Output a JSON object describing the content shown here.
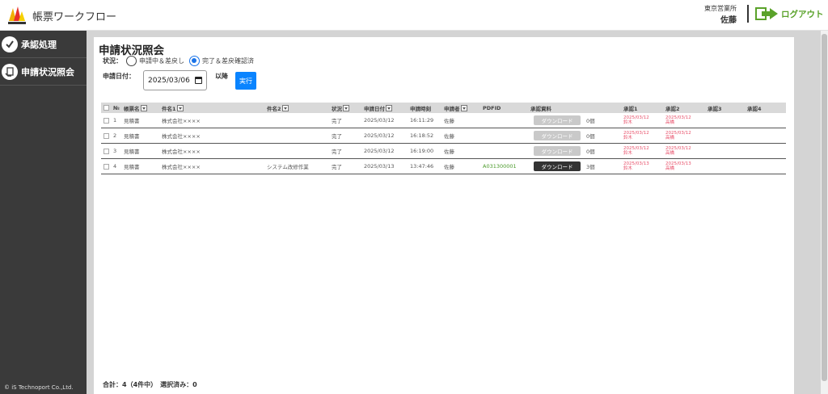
{
  "header": {
    "app_title": "帳票ワークフロー",
    "logo_text": "iS Technoport",
    "office": "東京営業所",
    "user": "佐藤",
    "logout_label": "ログアウト"
  },
  "sidebar": {
    "items": [
      {
        "label": "承認処理",
        "icon": "check-circle-icon"
      },
      {
        "label": "申請状況照会",
        "icon": "document-hand-icon"
      }
    ],
    "copyright": "© iS Technoport Co.,Ltd."
  },
  "main": {
    "title": "申請状況照会",
    "status_label": "状況：",
    "status_options": [
      "申請中＆差戻し",
      "完了＆差戻確認済"
    ],
    "status_selected": 1,
    "date_label": "申請日付：",
    "date_value": "2025/03/06",
    "after_label": "以降",
    "run_label": "実行",
    "footer": "合計：4（4件中）　選択済み：0"
  },
  "table": {
    "columns": [
      "№",
      "帳票名",
      "件名1",
      "件名2",
      "状況",
      "申請日付",
      "申請時刻",
      "申請者",
      "PDFID",
      "承認資料",
      "承認1",
      "承認2",
      "承認3",
      "承認4"
    ],
    "rows": [
      {
        "no": "1",
        "form": "見積書",
        "subject1": "株式会社××××",
        "subject2": "",
        "status": "完了",
        "date": "2025/03/12",
        "time": "16:11:29",
        "applicant": "佐藤",
        "pdfid": "",
        "download": "ダウンロード",
        "download_enabled": false,
        "count": "0個",
        "a1_date": "2025/03/12",
        "a1_name": "鈴木",
        "a2_date": "2025/03/12",
        "a2_name": "高橋"
      },
      {
        "no": "2",
        "form": "見積書",
        "subject1": "株式会社××××",
        "subject2": "",
        "status": "完了",
        "date": "2025/03/12",
        "time": "16:18:52",
        "applicant": "佐藤",
        "pdfid": "",
        "download": "ダウンロード",
        "download_enabled": false,
        "count": "0個",
        "a1_date": "2025/03/12",
        "a1_name": "鈴木",
        "a2_date": "2025/03/12",
        "a2_name": "高橋"
      },
      {
        "no": "3",
        "form": "見積書",
        "subject1": "株式会社××××",
        "subject2": "",
        "status": "完了",
        "date": "2025/03/12",
        "time": "16:19:00",
        "applicant": "佐藤",
        "pdfid": "",
        "download": "ダウンロード",
        "download_enabled": false,
        "count": "0個",
        "a1_date": "2025/03/12",
        "a1_name": "鈴木",
        "a2_date": "2025/03/12",
        "a2_name": "高橋"
      },
      {
        "no": "4",
        "form": "見積書",
        "subject1": "株式会社××××",
        "subject2": "システム改修作業",
        "status": "完了",
        "date": "2025/03/13",
        "time": "13:47:46",
        "applicant": "佐藤",
        "pdfid": "A031300001",
        "download": "ダウンロード",
        "download_enabled": true,
        "count": "3個",
        "a1_date": "2025/03/13",
        "a1_name": "鈴木",
        "a2_date": "2025/03/13",
        "a2_name": "高橋"
      }
    ]
  },
  "colors": {
    "sidebar_bg": "#3a3a3a",
    "accent_blue": "#0a84ff",
    "approval_red": "#e8506a",
    "logout_green": "#5aa22a"
  }
}
